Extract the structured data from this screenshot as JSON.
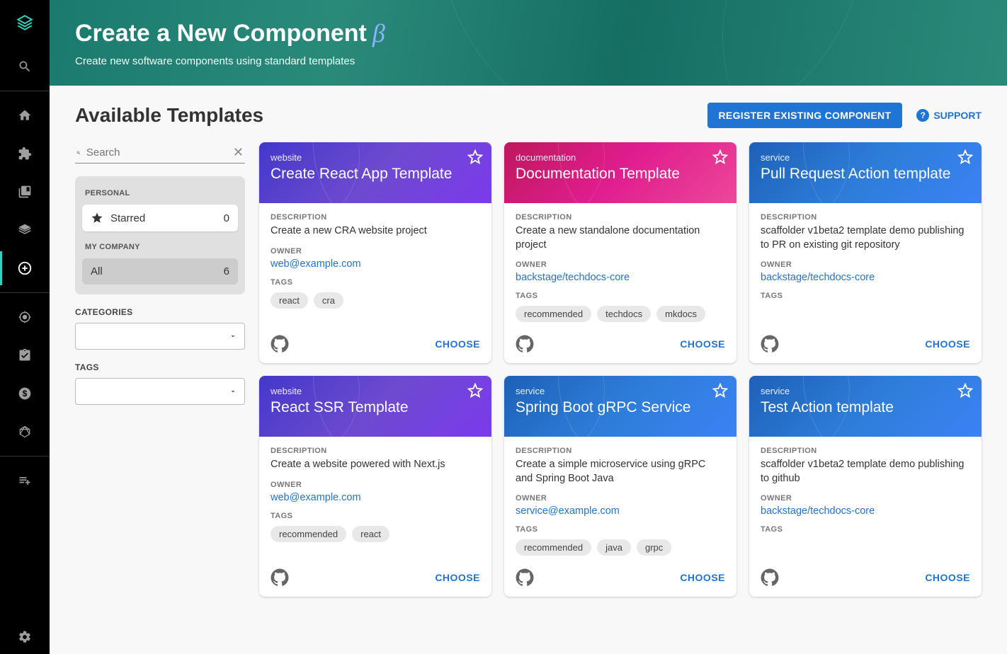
{
  "banner": {
    "title": "Create a New Component",
    "beta": "β",
    "subtitle": "Create new software components using standard templates"
  },
  "header": {
    "section_title": "Available Templates",
    "register_button": "REGISTER EXISTING COMPONENT",
    "support_label": "SUPPORT"
  },
  "filters": {
    "search_placeholder": "Search",
    "personal_label": "PERSONAL",
    "starred_label": "Starred",
    "starred_count": "0",
    "company_label": "MY COMPANY",
    "all_label": "All",
    "all_count": "6",
    "categories_label": "CATEGORIES",
    "tags_label": "TAGS"
  },
  "labels": {
    "description": "DESCRIPTION",
    "owner": "OWNER",
    "tags": "TAGS",
    "choose": "CHOOSE"
  },
  "cards": [
    {
      "type": "website",
      "color": "purple",
      "title": "Create React App Template",
      "description": "Create a new CRA website project",
      "owner": "web@example.com",
      "tags": [
        "react",
        "cra"
      ]
    },
    {
      "type": "documentation",
      "color": "pink",
      "title": "Documentation Template",
      "description": "Create a new standalone documentation project",
      "owner": "backstage/techdocs-core",
      "tags": [
        "recommended",
        "techdocs",
        "mkdocs"
      ]
    },
    {
      "type": "service",
      "color": "blue",
      "title": "Pull Request Action template",
      "description": "scaffolder v1beta2 template demo publishing to PR on existing git repository",
      "owner": "backstage/techdocs-core",
      "tags": []
    },
    {
      "type": "website",
      "color": "purple",
      "title": "React SSR Template",
      "description": "Create a website powered with Next.js",
      "owner": "web@example.com",
      "tags": [
        "recommended",
        "react"
      ]
    },
    {
      "type": "service",
      "color": "blue",
      "title": "Spring Boot gRPC Service",
      "description": "Create a simple microservice using gRPC and Spring Boot Java",
      "owner": "service@example.com",
      "tags": [
        "recommended",
        "java",
        "grpc"
      ]
    },
    {
      "type": "service",
      "color": "blue",
      "title": "Test Action template",
      "description": "scaffolder v1beta2 template demo publishing to github",
      "owner": "backstage/techdocs-core",
      "tags": []
    }
  ]
}
